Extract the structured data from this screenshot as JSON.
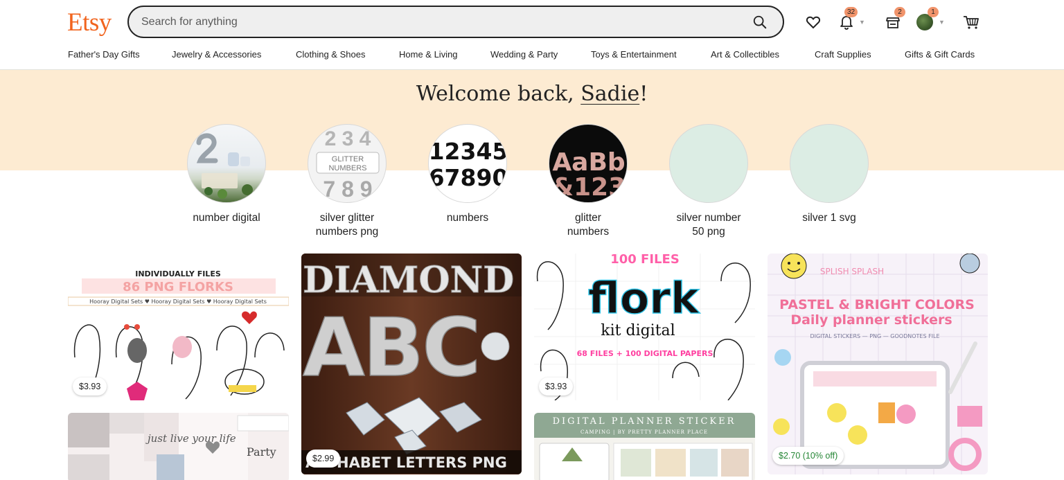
{
  "header": {
    "logo": "Etsy",
    "search_placeholder": "Search for anything",
    "badges": {
      "notifications": "32",
      "shop": "2",
      "account": "1"
    }
  },
  "nav": [
    "Father's Day Gifts",
    "Jewelry & Accessories",
    "Clothing & Shoes",
    "Home & Living",
    "Wedding & Party",
    "Toys & Entertainment",
    "Art & Collectibles",
    "Craft Supplies",
    "Gifts & Gift Cards"
  ],
  "welcome": {
    "prefix": "Welcome back, ",
    "name": "Sadie",
    "suffix": "!"
  },
  "searches": [
    {
      "line1": "number digital",
      "line2": ""
    },
    {
      "line1": "silver glitter",
      "line2": "numbers png"
    },
    {
      "line1": "numbers",
      "line2": ""
    },
    {
      "line1": "glitter",
      "line2": "numbers"
    },
    {
      "line1": "silver number",
      "line2": "50 png"
    },
    {
      "line1": "silver 1 svg",
      "line2": ""
    }
  ],
  "circle_art": {
    "silver_top": "2 3 4",
    "silver_sign1": "GLITTER",
    "silver_sign2": "NUMBERS",
    "silver_bottom": "7 8 9",
    "numbers_row1": "12345",
    "numbers_row2": "67890",
    "glitter_row1": "AaBb",
    "glitter_row2": "&123"
  },
  "listings": [
    {
      "price": "$3.93",
      "art1": "INDIVIDUALLY FILES",
      "art2": "86 PNG FLORKS",
      "art3": "Hooray Digital Sets ♥ Hooray Digital Sets ♥ Hooray Digital Sets"
    },
    {
      "price": "$2.99",
      "art1": "DIAMOND",
      "art2": "ABC",
      "art3": "ALPHABET LETTERS PNG"
    },
    {
      "price": "$3.93",
      "art1": "100 FILES",
      "art2": "flork",
      "art3": "kit digital",
      "art4": "68 FILES + 100 DIGITAL PAPERS"
    },
    {
      "price": "$2.70 (10% off)",
      "art1": "PASTEL & BRIGHT COLORS",
      "art2": "Daily planner stickers",
      "art3": "DIGITAL STICKERS — PNG — GOODNOTES FILE",
      "art4": "SPLISH SPLASH"
    },
    {
      "price": "",
      "art1": "just live your life",
      "art2": "Party"
    },
    {
      "price": "",
      "art1": "DIGITAL PLANNER STICKER",
      "art2": "CAMPING | BY PRETTY PLANNER PLACE"
    }
  ],
  "colors": {
    "brand": "#F1641E",
    "welcome_band": "#FDEBD2",
    "badge": "#F1946B",
    "sale_price": "#258635"
  }
}
